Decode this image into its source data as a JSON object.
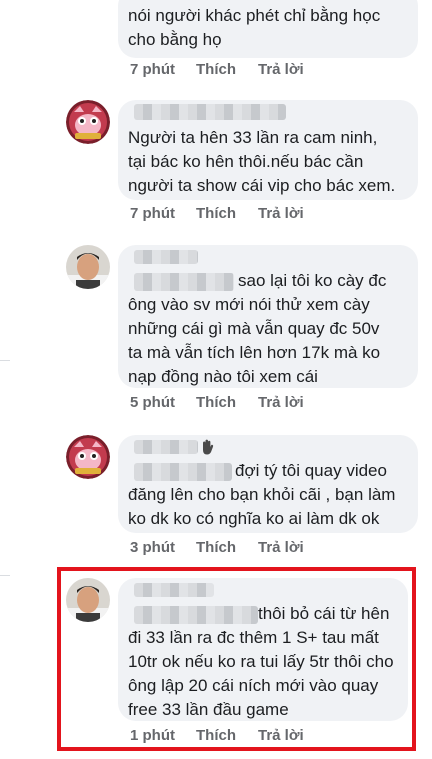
{
  "comments": [
    {
      "lines": [
        "nói người khác phét chỉ bằng học",
        "cho bằng họ"
      ],
      "time": "7 phút",
      "like": "Thích",
      "reply": "Trả lời"
    },
    {
      "lines": [
        "Người ta hên 33 lần ra cam ninh,",
        "tại bác ko hên thôi.nếu bác cần",
        "người ta show cái vip cho bác xem."
      ],
      "time": "7 phút",
      "like": "Thích",
      "reply": "Trả lời"
    },
    {
      "lines": [
        "sao lại tôi ko cày đc",
        "ông vào sv mới nói thử xem cày",
        "những cái gì mà vẫn quay đc 50v",
        "ta mà vẫn tích lên hơn 17k mà ko",
        "nạp đồng nào tôi xem cái"
      ],
      "time": "5 phút",
      "like": "Thích",
      "reply": "Trả lời"
    },
    {
      "lines": [
        "đợi tý tôi quay video",
        "đăng lên cho bạn khỏi cãi , bạn làm",
        "ko dk ko có nghĩa ko ai làm dk ok"
      ],
      "time": "3 phút",
      "like": "Thích",
      "reply": "Trả lời"
    },
    {
      "lines": [
        "thôi bỏ cái từ hên",
        "đi 33 lần ra đc thêm 1 S+ tau mất",
        "10tr ok nếu ko ra tui lấy 5tr thôi cho",
        "ông lập  20 cái ních mới vào quay",
        "free 33 lần đầu game"
      ],
      "time": "1 phút",
      "like": "Thích",
      "reply": "Trả lời"
    }
  ],
  "colors": {
    "bubble_bg": "#f0f2f5",
    "text": "#1c1e21",
    "meta_text": "#65676b",
    "highlight_box": "#e3141d"
  },
  "icons": {
    "avatar_cartoon": "pink-cartoon-avatar",
    "avatar_person": "person-photo-avatar",
    "reaction": "waving-hand-icon"
  }
}
